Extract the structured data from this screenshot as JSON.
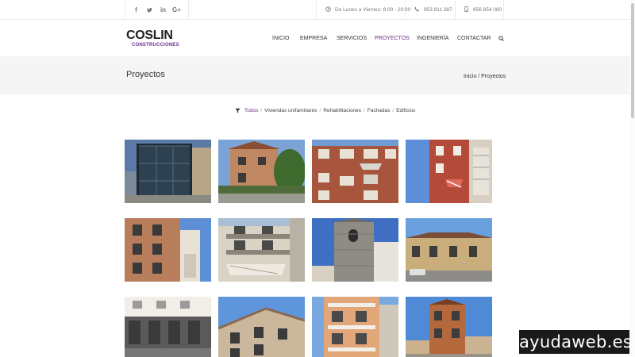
{
  "topbar": {
    "social": [
      {
        "name": "facebook-icon",
        "glyph": "f"
      },
      {
        "name": "twitter-icon",
        "glyph": "t"
      },
      {
        "name": "linkedin-icon",
        "glyph": "in"
      },
      {
        "name": "googleplus-icon",
        "glyph": "G+"
      }
    ],
    "hours": "De Lunes a Viernes: 8:00 - 20:00",
    "phone": "953 811 387",
    "mobile": "656 854 080"
  },
  "header": {
    "logo_main": "COSLIN",
    "logo_sub": "CONSTRUCCIONES",
    "nav": [
      "INICIO",
      "EMPRESA",
      "SERVICIOS",
      "PROYECTOS",
      "INGENIERÍA",
      "CONTACTAR"
    ],
    "active_nav": "PROYECTOS"
  },
  "title_band": {
    "title": "Proyectos",
    "breadcrumb": "Inicio / Proyectos"
  },
  "filters": {
    "items": [
      "Todos",
      "Viviendas unifamiliares",
      "Rehabilitaciones",
      "Fachadas",
      "Edificios"
    ],
    "active": "Todos"
  },
  "gallery": {
    "items": [
      "project-photo-1",
      "project-photo-2",
      "project-photo-3",
      "project-photo-4",
      "project-photo-5",
      "project-photo-6",
      "project-photo-7",
      "project-photo-8",
      "project-photo-9",
      "project-photo-10",
      "project-photo-11",
      "project-photo-12"
    ]
  },
  "watermark": "ayudaweb.es",
  "colors": {
    "accent": "#6a2f86",
    "title_band": "#f5f5f5",
    "text": "#333333"
  }
}
